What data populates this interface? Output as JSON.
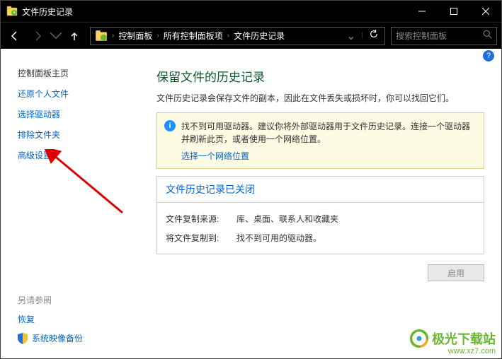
{
  "titlebar": {
    "title": "文件历史记录"
  },
  "breadcrumb": {
    "items": [
      "控制面板",
      "所有控制面板项",
      "文件历史记录"
    ]
  },
  "search": {
    "placeholder": "搜索控制面板"
  },
  "sidebar": {
    "title": "控制面板主页",
    "links": [
      "还原个人文件",
      "选择驱动器",
      "排除文件夹",
      "高级设置"
    ],
    "footer_title": "另请参阅",
    "footer_links": [
      "恢复",
      "系统映像备份"
    ]
  },
  "main": {
    "heading": "保留文件的历史记录",
    "desc": "文件历史记录会保存文件的副本，因此在文件丢失或损坏时，你可以找回它们。",
    "info_text": "找不到可用驱动器。建议你将外部驱动器用于文件历史记录。连接一个驱动器并刷新此页，或者使用一个网络位置。",
    "info_link": "选择一个网络位置",
    "status_header": "文件历史记录已关闭",
    "rows": [
      {
        "label": "文件复制来源:",
        "value": "库、桌面、联系人和收藏夹"
      },
      {
        "label": "将文件复制到:",
        "value": "找不到可用的驱动器。"
      }
    ],
    "enable_btn": "启用"
  },
  "watermark": {
    "text": "极光下载站",
    "url": "www.xz7.com"
  }
}
